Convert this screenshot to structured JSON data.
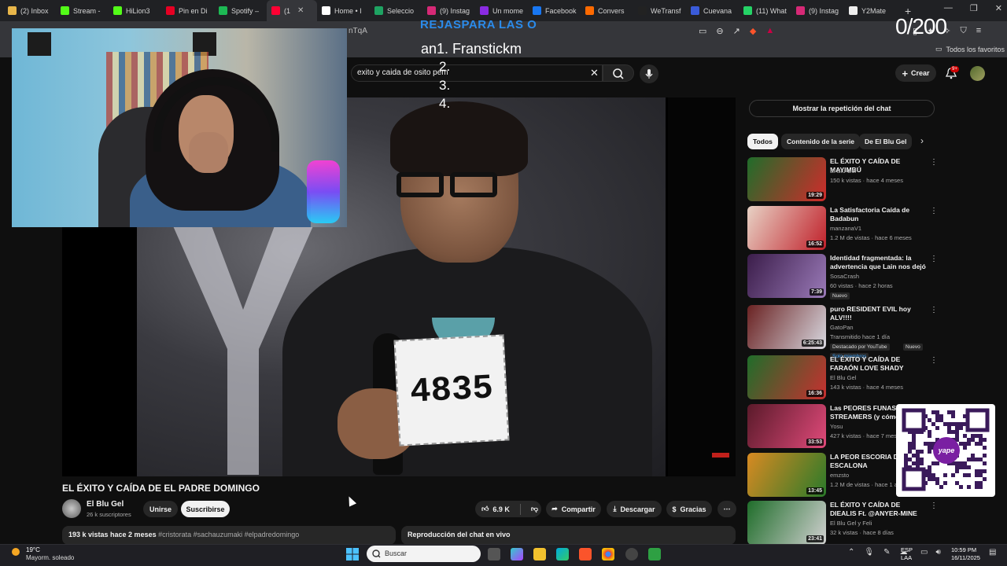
{
  "browser": {
    "tabs": [
      {
        "label": "(2) Inbox",
        "color": "#e8b64a"
      },
      {
        "label": "Stream -",
        "color": "#53fc18"
      },
      {
        "label": "HiLion3",
        "color": "#53fc18"
      },
      {
        "label": "Pin en Di",
        "color": "#e60023"
      },
      {
        "label": "Spotify –",
        "color": "#1db954"
      },
      {
        "label": "(1",
        "color": "#ff0033",
        "active": true
      },
      {
        "label": "Home • I",
        "color": "#ffffff"
      },
      {
        "label": "Seleccio",
        "color": "#1ea362"
      },
      {
        "label": "(9) Instag",
        "color": "#d62976"
      },
      {
        "label": "Un mome",
        "color": "#8a2be2"
      },
      {
        "label": "Facebook",
        "color": "#1877f2"
      },
      {
        "label": "Convers",
        "color": "#ff6a00"
      },
      {
        "label": "WeTransf",
        "color": "#222222"
      },
      {
        "label": "Cuevana",
        "color": "#3a5bd9"
      },
      {
        "label": "(11) What",
        "color": "#25d366"
      },
      {
        "label": "(9) Instag",
        "color": "#d62976"
      },
      {
        "label": "Y2Mate",
        "color": "#eeeeee"
      }
    ],
    "new_tab": "+",
    "url_fragment": "nTqA",
    "bookmarks_all": "Todos los favoritos"
  },
  "header": {
    "search_value": "exito y caida de osito pem",
    "create_label": "Crear",
    "notifications_count": "9+"
  },
  "overlay": {
    "title": "REJASPARA LAS O",
    "line1": "an1. Franstickm",
    "line2": "2.",
    "line3": "3.",
    "line4": "4.",
    "counter": "0/200"
  },
  "video": {
    "number_tag": "4835",
    "title": "EL ÉXITO Y CAÍDA DE EL PADRE DOMINGO",
    "channel": "El Blu Gel",
    "subscribers": "26 k suscriptores",
    "join_label": "Unirse",
    "subscribe_label": "Suscribirse",
    "likes": "6.9 K",
    "share_label": "Compartir",
    "download_label": "Descargar",
    "thanks_label": "Gracias",
    "more_label": "⋯",
    "views_date": "193 k vistas  hace 2 meses",
    "tags": "#cristorata #sachauzumaki #elpadredomingo",
    "chat_replay_label": "Reproducción del chat en vivo"
  },
  "sidebar": {
    "show_chat_label": "Mostrar la repetición del chat",
    "chips": [
      "Todos",
      "Contenido de la serie",
      "De El Blu Gel"
    ],
    "recommendations": [
      {
        "title": "EL ÉXITO Y CAÍDA DE MAYIMBÚ",
        "channel": "El Blu Gel",
        "meta": "150 k vistas · hace 4 meses",
        "duration": "19:29",
        "thumb": "#1f6d2a",
        "thumb2": "#d12b2b"
      },
      {
        "title": "La Satisfactoria Caída de Badabun",
        "channel": "manzanaV1",
        "meta": "1.2 M de vistas · hace 6 meses",
        "duration": "16:52",
        "thumb": "#e8d2c5",
        "thumb2": "#c0202a"
      },
      {
        "title": "Identidad fragmentada: la advertencia que Lain nos dejó",
        "channel": "SosaCrash",
        "meta": "60 vistas · hace 2 horas",
        "badge": "Nuevo",
        "duration": "7:39",
        "thumb": "#3b1d4a",
        "thumb2": "#9a7ab8"
      },
      {
        "title": "puro RESIDENT EVIL hoy ALV!!!!",
        "channel": "GatoPan",
        "meta": "Transmitido hace 1 día",
        "badge": "Destacado por YouTube",
        "badge2": "Nuevo",
        "members": "Solo miembros",
        "duration": "6:25:43",
        "thumb": "#6a2222",
        "thumb2": "#d8d8e0"
      },
      {
        "title": "EL ÉXITO Y CAÍDA DE FARAÓN LOVE SHADY",
        "channel": "El Blu Gel",
        "meta": "143 k vistas · hace 4 meses",
        "duration": "16:36",
        "thumb": "#1f6d2a",
        "thumb2": "#c83030"
      },
      {
        "title": "Las PEORES FUNAS a STREAMERS (y cómo",
        "channel": "Yosu",
        "meta": "427 k vistas · hace 7 mes",
        "duration": "33:53",
        "thumb": "#5a1a2a",
        "thumb2": "#e04a7a"
      },
      {
        "title": "LA PEOR ESCORIA DE BORJA ESCALONA",
        "channel": "emzsto",
        "meta": "1.2 M de vistas · hace 1 a",
        "duration": "13:45",
        "thumb": "#d88a22",
        "thumb2": "#2a7a2a"
      },
      {
        "title": "EL ÉXITO Y CAÍDA DE DIEALIS Ft. @ANYER-MINE",
        "channel": "El Blu Gel y Feli",
        "meta": "32 k vistas · hace 8 días",
        "duration": "23:41",
        "thumb": "#1f6d2a",
        "thumb2": "#d0d0d0"
      }
    ],
    "qr_label": "yape"
  },
  "taskbar": {
    "temperature": "19°C",
    "weather": "Mayorm. soleado",
    "search_placeholder": "Buscar",
    "lang1": "ESP",
    "lang2": "LAA",
    "time": "10:59 PM",
    "date": "16/11/2025"
  }
}
